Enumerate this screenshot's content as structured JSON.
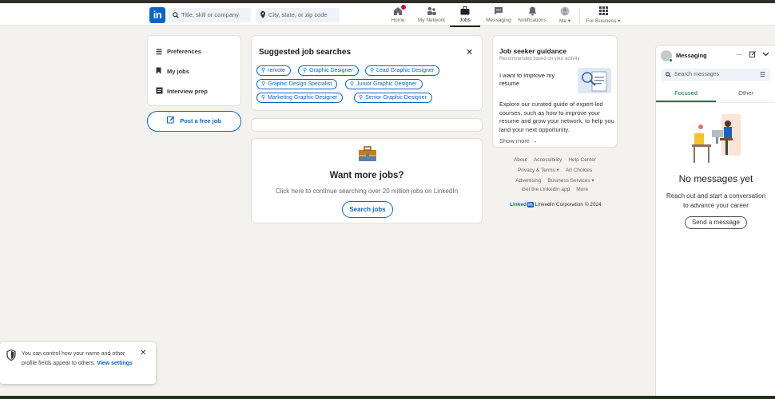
{
  "header": {
    "logo_text": "in",
    "search_placeholder": "Title, skill or company",
    "location_placeholder": "City, state, or zip code",
    "nav": [
      {
        "label": "Home",
        "icon": "home-icon"
      },
      {
        "label": "My Network",
        "icon": "network-icon"
      },
      {
        "label": "Jobs",
        "icon": "briefcase-icon",
        "active": true
      },
      {
        "label": "Messaging",
        "icon": "messaging-icon"
      },
      {
        "label": "Notifications",
        "icon": "bell-icon"
      },
      {
        "label": "Me",
        "icon": "avatar-icon"
      },
      {
        "label": "For Business",
        "icon": "grid-icon"
      }
    ]
  },
  "left": {
    "items": [
      {
        "label": "Preferences",
        "icon": "list-icon"
      },
      {
        "label": "My jobs",
        "icon": "bookmark-icon"
      },
      {
        "label": "Interview prep",
        "icon": "clipboard-icon"
      }
    ],
    "post_job_label": "Post a free job"
  },
  "suggested": {
    "title": "Suggested job searches",
    "chips": [
      "remote",
      "Graphic Designer",
      "Lead Graphic Designer",
      "Graphic Design Specialist",
      "Junior Graphic Designer",
      "Marketing Graphic Designer",
      "Senior Graphic Designer"
    ]
  },
  "more_jobs": {
    "title": "Want more jobs?",
    "subtitle": "Click here to continue searching over 20 million jobs on LinkedIn",
    "button": "Search jobs"
  },
  "guidance": {
    "title": "Job seeker guidance",
    "subtitle": "Recommended based on your activity",
    "improve": "I want to improve my resume",
    "description": "Explore our curated guide of expert-led courses, such as how to improve your resume and grow your network, to help you land your next opportunity.",
    "show_more": "Show more"
  },
  "footer": {
    "row1": [
      "About",
      "Accessibility",
      "Help Center"
    ],
    "row2": [
      "Privacy & Terms ▾",
      "Ad Choices"
    ],
    "row3": [
      "Advertising",
      "Business Services ▾"
    ],
    "row4": [
      "Get the LinkedIn app",
      "More"
    ],
    "brand": "Linked",
    "brand_in": "in",
    "copyright": "LinkedIn Corporation © 2024"
  },
  "messaging": {
    "title": "Messaging",
    "search_placeholder": "Search messages",
    "tabs": [
      "Focused",
      "Other"
    ],
    "empty_title": "No messages yet",
    "empty_body": "Reach out and start a conversation to advance your career",
    "send_button": "Send a message"
  },
  "toast": {
    "text": "You can control how your name and other profile fields appear to others.",
    "link": "View settings"
  },
  "colors": {
    "brand": "#0a66c2",
    "page_bg": "#f4f2ee",
    "online": "#057642"
  }
}
